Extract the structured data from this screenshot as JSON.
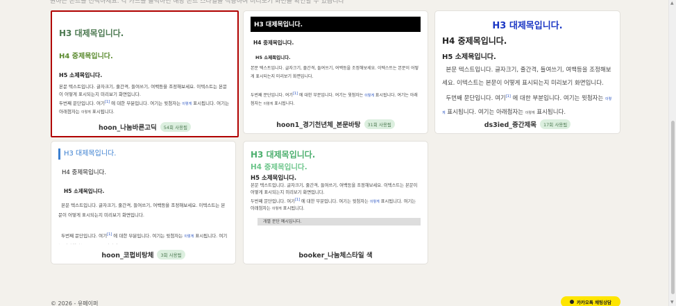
{
  "top_text": "원하는 폰트를 선택하세요. 각 카드를 클릭하면 해당 폰트 스타일을 적용하여 미리보기 화면을 확인할 수 있습니다",
  "sample": {
    "h3": "H3 대제목입니다.",
    "h4": "H4 중제목입니다.",
    "h5": "H5 소제목입니다.",
    "p1": "본문 텍스트입니다. 글자크기, 줄간격, 들여쓰기, 여백등을 조정해보세요. 이텍스트는 본문이 어떻게 표시되는지 미리보기 화면입니다.",
    "p2_a": "두번째 문단입니다. 여기",
    "footnote": "[1]",
    "p2_b": " 에 대한 부분입니다. 여기는 윗첨자는 ",
    "sup_word": "이렇게",
    "p2_c": " 표시됩니다. 여기는 아래첨자는 ",
    "sub_word": "이렇게",
    "p2_d": " 표시됩니다.",
    "separate_para": "개별 문단 예시입니다."
  },
  "fonts": [
    {
      "name": "hoon_나눔바른고딕",
      "badge": "54회 사용됨"
    },
    {
      "name": "hoon1_경기천년체_본문바탕",
      "badge": "31회 사용됨"
    },
    {
      "name": "ds3ied_중간제목",
      "badge": "17회 사용됨"
    },
    {
      "name": "hoon_코펍비탕체",
      "badge": "3회 사용됨"
    },
    {
      "name": "booker_나눔체스타일 색",
      "badge": ""
    }
  ],
  "footer": {
    "copyright": "© 2026 - 유페이퍼",
    "chat_label": "카카오톡 채팅상담"
  },
  "colors": {
    "selected_border": "#b00000",
    "badge_bg": "#dcefdf",
    "kakao_yellow": "#fee500"
  }
}
